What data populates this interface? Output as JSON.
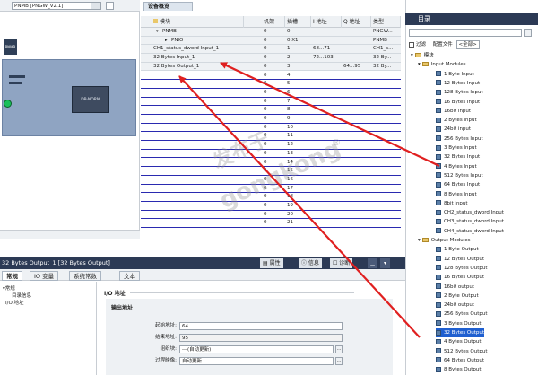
{
  "device_view": {
    "device_selector": "PNMB [PNGW_V2.1]",
    "station_tag": "PNMB",
    "module_label": "DP-NORM"
  },
  "overview": {
    "tab_label": "设备概览",
    "columns": [
      "模块",
      "机架",
      "插槽",
      "I 地址",
      "Q 地址",
      "类型"
    ],
    "rows": [
      {
        "name": "PNMB",
        "rack": "0",
        "slot": "0",
        "i_addr": "",
        "q_addr": "",
        "type": "PNGW..."
      },
      {
        "name": "PNIO",
        "rack": "0",
        "slot": "0 X1",
        "i_addr": "",
        "q_addr": "",
        "type": "PNMB"
      },
      {
        "name": "CH1_status_dword Input_1",
        "rack": "0",
        "slot": "1",
        "i_addr": "68...71",
        "q_addr": "",
        "type": "CH1_s..."
      },
      {
        "name": "32 Bytes Input_1",
        "rack": "0",
        "slot": "2",
        "i_addr": "72...103",
        "q_addr": "",
        "type": "32 By..."
      },
      {
        "name": "32 Bytes Output_1",
        "rack": "0",
        "slot": "3",
        "i_addr": "",
        "q_addr": "64...95",
        "type": "32 By..."
      }
    ],
    "empty_slots": [
      "4",
      "5",
      "6",
      "7",
      "8",
      "9",
      "10",
      "11",
      "12",
      "13",
      "14",
      "15",
      "16",
      "17",
      "18",
      "19",
      "20",
      "21"
    ],
    "empty_rack": "0"
  },
  "catalog": {
    "title": "目录",
    "filter_label": "过滤",
    "profile_label": "配置文件",
    "profile_value": "<全部>",
    "items": [
      {
        "label": "模块",
        "level": 0,
        "folder": true
      },
      {
        "label": "Input Modules",
        "level": 1,
        "folder": true
      },
      {
        "label": "1 Byte Input",
        "level": 2
      },
      {
        "label": "12 Bytes Input",
        "level": 2
      },
      {
        "label": "128 Bytes Input",
        "level": 2
      },
      {
        "label": "16 Bytes Input",
        "level": 2
      },
      {
        "label": "16bit input",
        "level": 2
      },
      {
        "label": "2 Bytes Input",
        "level": 2
      },
      {
        "label": "24bit input",
        "level": 2
      },
      {
        "label": "256 Bytes Input",
        "level": 2
      },
      {
        "label": "3 Bytes Input",
        "level": 2
      },
      {
        "label": "32 Bytes Input",
        "level": 2
      },
      {
        "label": "4 Bytes Input",
        "level": 2
      },
      {
        "label": "512 Bytes Input",
        "level": 2
      },
      {
        "label": "64 Bytes Input",
        "level": 2
      },
      {
        "label": "8 Bytes Input",
        "level": 2
      },
      {
        "label": "8bit input",
        "level": 2
      },
      {
        "label": "CH2_status_dword Input",
        "level": 2
      },
      {
        "label": "CH3_status_dword Input",
        "level": 2
      },
      {
        "label": "CH4_status_dword Input",
        "level": 2
      },
      {
        "label": "Output Modules",
        "level": 1,
        "folder": true
      },
      {
        "label": "1 Byte Output",
        "level": 2
      },
      {
        "label": "12 Bytes Output",
        "level": 2
      },
      {
        "label": "128 Bytes Output",
        "level": 2
      },
      {
        "label": "16 Bytes Output",
        "level": 2
      },
      {
        "label": "16bit output",
        "level": 2
      },
      {
        "label": "2 Byte Output",
        "level": 2
      },
      {
        "label": "24bit output",
        "level": 2
      },
      {
        "label": "256 Bytes Output",
        "level": 2
      },
      {
        "label": "3 Bytes Output",
        "level": 2
      },
      {
        "label": "32 Bytes Output",
        "level": 2,
        "selected": true
      },
      {
        "label": "4 Bytes Output",
        "level": 2
      },
      {
        "label": "512 Bytes Output",
        "level": 2
      },
      {
        "label": "64 Bytes Output",
        "level": 2
      },
      {
        "label": "8 Bytes Output",
        "level": 2
      }
    ]
  },
  "properties": {
    "title": "32 Bytes Output_1 [32 Bytes Output]",
    "tabs": [
      "属性",
      "信息",
      "诊断"
    ],
    "subtabs": [
      "常规",
      "IO 变量",
      "系统常数",
      "文本"
    ],
    "tree": [
      {
        "label": "常规",
        "level": 0
      },
      {
        "label": "目录信息",
        "level": 1
      },
      {
        "label": "I/O 地址",
        "level": 0
      }
    ],
    "section_title": "I/O 地址",
    "subsection_title": "输出地址",
    "fields": {
      "start_label": "起始地址:",
      "start_value": "64",
      "end_label": "结束地址:",
      "end_value": "95",
      "ob_label": "组织块:",
      "ob_value": "---(自动更新)",
      "pip_label": "过程映像:",
      "pip_value": "自动更新"
    }
  },
  "watermark": {
    "line1": "发布于",
    "line2": "gongkong",
    "mark": "®"
  },
  "colors": {
    "header_dark": "#2c3a55",
    "arrow": "#e02020",
    "row_line": "#2a2ab0",
    "selected": "#1f5fd0"
  }
}
